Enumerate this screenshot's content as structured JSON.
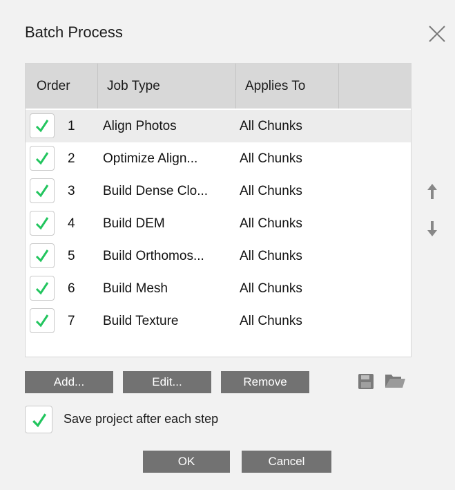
{
  "dialog": {
    "title": "Batch Process"
  },
  "table": {
    "headers": {
      "order": "Order",
      "job_type": "Job Type",
      "applies_to": "Applies To"
    },
    "rows": [
      {
        "checked": true,
        "order": "1",
        "job_type": "Align Photos",
        "applies_to": "All Chunks"
      },
      {
        "checked": true,
        "order": "2",
        "job_type": "Optimize Align...",
        "applies_to": "All Chunks"
      },
      {
        "checked": true,
        "order": "3",
        "job_type": "Build Dense Clo...",
        "applies_to": "All Chunks"
      },
      {
        "checked": true,
        "order": "4",
        "job_type": "Build DEM",
        "applies_to": "All Chunks"
      },
      {
        "checked": true,
        "order": "5",
        "job_type": "Build Orthomos...",
        "applies_to": "All Chunks"
      },
      {
        "checked": true,
        "order": "6",
        "job_type": "Build Mesh",
        "applies_to": "All Chunks"
      },
      {
        "checked": true,
        "order": "7",
        "job_type": "Build Texture",
        "applies_to": "All Chunks"
      }
    ]
  },
  "buttons": {
    "add": "Add...",
    "edit": "Edit...",
    "remove": "Remove",
    "ok": "OK",
    "cancel": "Cancel"
  },
  "options": {
    "save_after_each_step": {
      "label": "Save project after each step",
      "checked": true
    }
  },
  "icons": {
    "close": "close-icon",
    "move_up": "arrow-up-icon",
    "move_down": "arrow-down-icon",
    "save": "save-icon",
    "open": "folder-icon",
    "check": "check-icon"
  },
  "colors": {
    "check": "#22c55e",
    "button": "#727272",
    "header": "#d8d8d8",
    "selected_row": "#ececec"
  }
}
